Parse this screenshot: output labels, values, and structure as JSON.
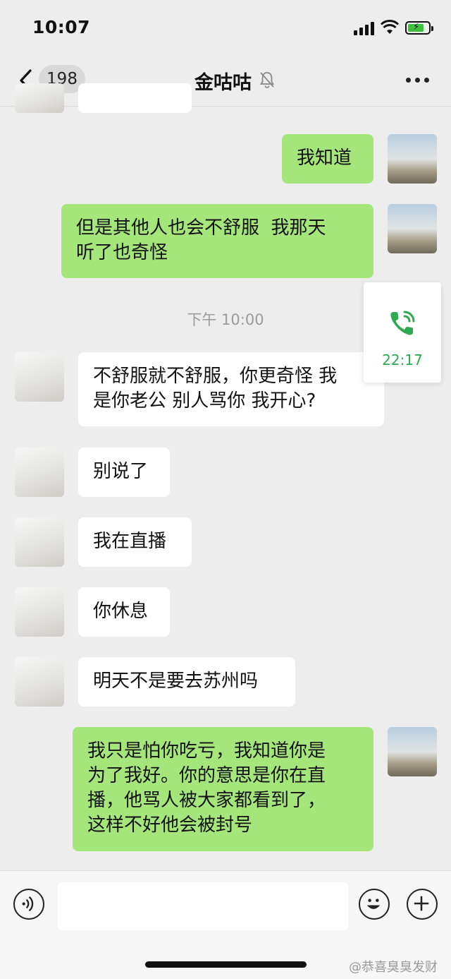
{
  "status_bar": {
    "time": "10:07"
  },
  "nav": {
    "back_count": "198",
    "title": "金咕咕"
  },
  "timestamp": "下午 10:00",
  "call_float": {
    "duration": "22:17"
  },
  "messages": [
    {
      "side": "in",
      "text": ""
    },
    {
      "side": "out",
      "text": "我知道"
    },
    {
      "side": "out",
      "text": "但是其他人也会不舒服  我那天\n听了也奇怪"
    },
    {
      "side": "in",
      "text": "不舒服就不舒服，你更奇怪 我\n是你老公 别人骂你 我开心?"
    },
    {
      "side": "in",
      "text": "别说了"
    },
    {
      "side": "in",
      "text": "我在直播"
    },
    {
      "side": "in",
      "text": "你休息"
    },
    {
      "side": "in",
      "text": "明天不是要去苏州吗"
    },
    {
      "side": "out",
      "text": "我只是怕你吃亏，我知道你是\n为了我好。你的意思是你在直\n播，他骂人被大家都看到了，\n这样不好他会被封号"
    }
  ],
  "input": {
    "value": ""
  },
  "watermark": "@恭喜臭臭发财",
  "colors": {
    "outgoing": "#a5e67b",
    "incoming": "#ffffff",
    "background": "#ededed",
    "call_green": "#2fa84f"
  }
}
